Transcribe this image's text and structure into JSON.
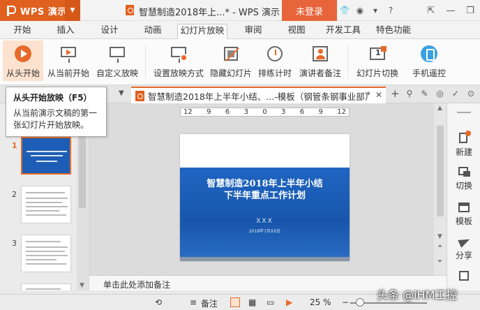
{
  "titlebar": {
    "app_name": "WPS 演示",
    "doc_title": "智慧制造2018年上...* - WPS 演示",
    "login_label": "未登录"
  },
  "menu": {
    "tabs": [
      "开始",
      "插入",
      "设计",
      "动画",
      "幻灯片放映",
      "审阅",
      "视图",
      "开发工具",
      "特色功能"
    ],
    "active": "幻灯片放映"
  },
  "ribbon": {
    "from_start": "从头开始",
    "from_current": "从当前开始",
    "custom_show": "自定义放映",
    "setup_show": "设置放映方式",
    "hide_slide": "隐藏幻灯片",
    "rehearse": "排练计时",
    "presenter_notes": "演讲者备注",
    "slide_transition": "幻灯片切换",
    "phone_remote": "手机遥控"
  },
  "tooltip": {
    "title": "从头开始放映（F5）",
    "description": "从当前演示文稿的第一张幻灯片开始放映。"
  },
  "doc_tab": {
    "label": "智慧制造2018年上半年小结、...-模板（钢管条钢事业部）",
    "modified": "*"
  },
  "thumbnails": {
    "numbers": [
      "1",
      "2",
      "3"
    ]
  },
  "ruler": {
    "ticks": [
      "12",
      "9",
      "6",
      "3",
      "0",
      "3",
      "6",
      "9",
      "12"
    ]
  },
  "slide": {
    "title_line1": "智慧制造2018年上半年小结",
    "title_line2": "下半年重点工作计划",
    "author": "XXX",
    "date": "2018年7月XX日"
  },
  "notes": {
    "placeholder": "单击此处添加备注"
  },
  "taskpane": {
    "items": [
      "新建",
      "切换",
      "模板",
      "分享"
    ]
  },
  "statusbar": {
    "notes_label": "备注",
    "zoom": "25 %"
  },
  "watermark": "头条 @iHM工控",
  "colors": {
    "accent": "#e86a2a",
    "slide_blue": "#1f65c2"
  }
}
